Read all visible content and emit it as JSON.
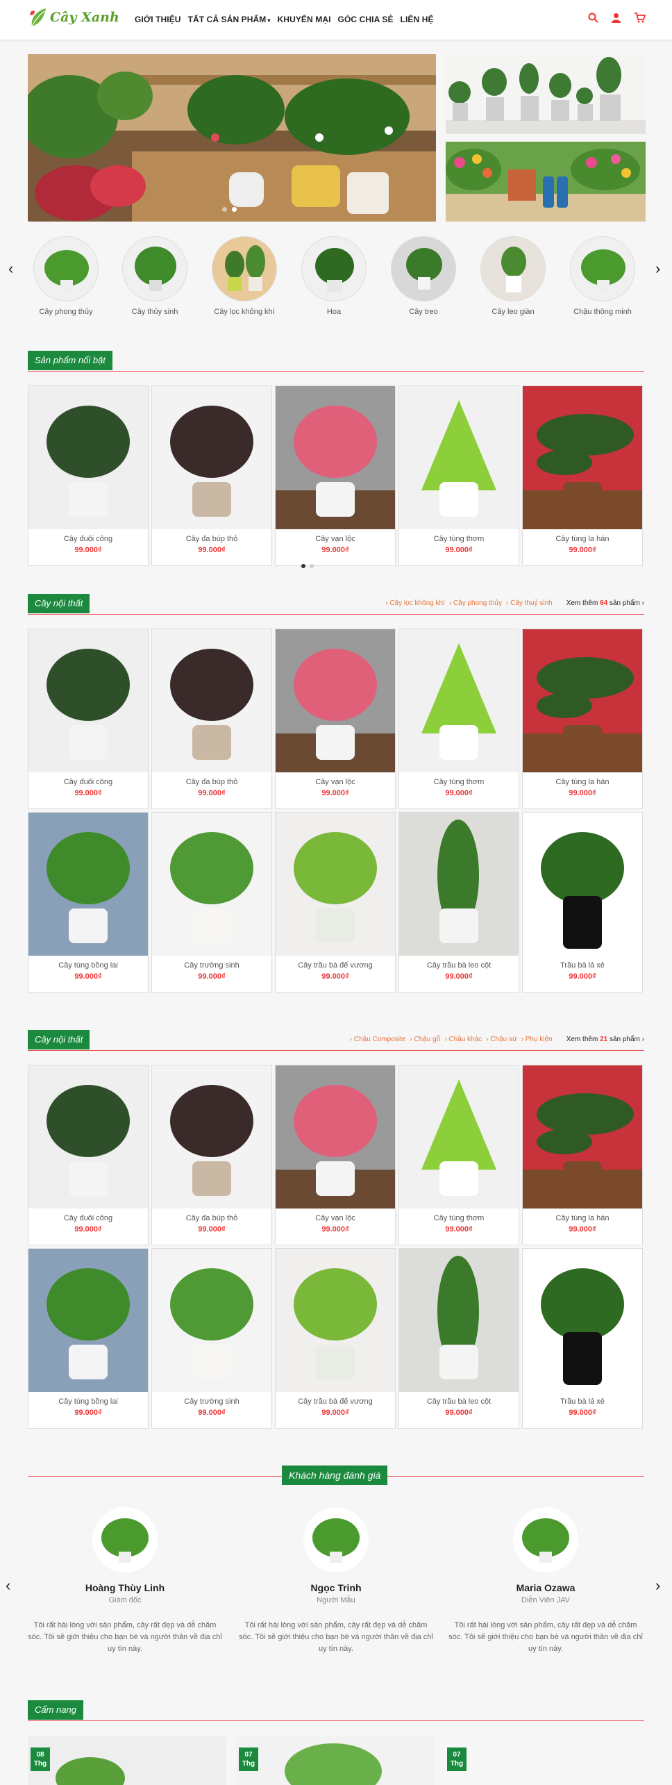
{
  "header": {
    "logo_text": "Cây Xanh",
    "nav": [
      "GIỚI THIỆU",
      "TẤT CẢ SẢN PHẨM",
      "KHUYẾN MẠI",
      "GÓC CHIA SẺ",
      "LIÊN HỆ"
    ],
    "icons": [
      "search-icon",
      "user-icon",
      "cart-icon"
    ]
  },
  "categories": [
    "Cây phong thủy",
    "Cây thủy sinh",
    "Cây lọc không khí",
    "Hoa",
    "Cây treo",
    "Cây leo giàn",
    "Chậu thông minh"
  ],
  "featured": {
    "title": "Sản phẩm nổi bật",
    "products": [
      {
        "name": "Cây đuôi công",
        "price": "99.000₫"
      },
      {
        "name": "Cây đa búp thỏ",
        "price": "99.000₫"
      },
      {
        "name": "Cây vạn lộc",
        "price": "99.000₫"
      },
      {
        "name": "Cây tùng thơm",
        "price": "99.000₫"
      },
      {
        "name": "Cây tùng la hán",
        "price": "99.000₫"
      }
    ]
  },
  "section1": {
    "title": "Cây nội thất",
    "links": [
      "Cây lọc không khí",
      "Cây phong thủy",
      "Cây thuỷ sinh"
    ],
    "more_prefix": "Xem thêm",
    "more_count": "64",
    "more_suffix": "sản phẩm",
    "products": [
      {
        "name": "Cây đuôi công",
        "price": "99.000₫"
      },
      {
        "name": "Cây đa búp thỏ",
        "price": "99.000₫"
      },
      {
        "name": "Cây vạn lộc",
        "price": "99.000₫"
      },
      {
        "name": "Cây tùng thơm",
        "price": "99.000₫"
      },
      {
        "name": "Cây tùng la hán",
        "price": "99.000₫"
      },
      {
        "name": "Cây tùng bồng lai",
        "price": "99.000₫"
      },
      {
        "name": "Cây trường sinh",
        "price": "99.000₫"
      },
      {
        "name": "Cây trầu bà đế vương",
        "price": "99.000₫"
      },
      {
        "name": "Cây trầu bà leo cột",
        "price": "99.000₫"
      },
      {
        "name": "Trầu bà lá xẻ",
        "price": "99.000₫"
      }
    ]
  },
  "section2": {
    "title": "Cây nội thất",
    "links": [
      "Chậu Composite",
      "Chậu gỗ",
      "Chậu khác",
      "Chậu sứ",
      "Phụ kiện"
    ],
    "more_prefix": "Xem thêm",
    "more_count": "21",
    "more_suffix": "sản phẩm",
    "products": [
      {
        "name": "Cây đuôi công",
        "price": "99.000₫"
      },
      {
        "name": "Cây đa búp thỏ",
        "price": "99.000₫"
      },
      {
        "name": "Cây vạn lộc",
        "price": "99.000₫"
      },
      {
        "name": "Cây tùng thơm",
        "price": "99.000₫"
      },
      {
        "name": "Cây tùng la hán",
        "price": "99.000₫"
      },
      {
        "name": "Cây tùng bồng lai",
        "price": "99.000₫"
      },
      {
        "name": "Cây trường sinh",
        "price": "99.000₫"
      },
      {
        "name": "Cây trầu bà đế vương",
        "price": "99.000₫"
      },
      {
        "name": "Cây trầu bà leo cột",
        "price": "99.000₫"
      },
      {
        "name": "Trầu bà lá xẻ",
        "price": "99.000₫"
      }
    ]
  },
  "testimonials": {
    "title": "Khách hàng đánh giá",
    "items": [
      {
        "name": "Hoàng Thùy Linh",
        "role": "Giám đốc",
        "quote": "Tôi rất hài lòng với sản phẩm, cây rất đẹp và dễ chăm sóc. Tôi sẽ giới thiệu cho bạn bè và người thân về địa chỉ uy tín này."
      },
      {
        "name": "Ngọc Trinh",
        "role": "Người Mẫu",
        "quote": "Tôi rất hài lòng với sản phẩm, cây rất đẹp và dễ chăm sóc. Tôi sẽ giới thiệu cho bạn bè và người thân về địa chỉ uy tín này."
      },
      {
        "name": "Maria Ozawa",
        "role": "Diễn Viên JAV",
        "quote": "Tôi rất hài lòng với sản phẩm, cây rất đẹp và dễ chăm sóc. Tôi sẽ giới thiệu cho bạn bè và người thân về địa chỉ uy tín này."
      }
    ]
  },
  "blog": {
    "title": "Cẩm nang",
    "dates": [
      {
        "day": "08",
        "label": "Thg"
      },
      {
        "day": "07",
        "label": "Thg"
      },
      {
        "day": "07",
        "label": "Thg"
      }
    ]
  },
  "colors": {
    "brand_green": "#1b8a3e",
    "accent_red": "#e33333",
    "link_orange": "#e8753c"
  }
}
